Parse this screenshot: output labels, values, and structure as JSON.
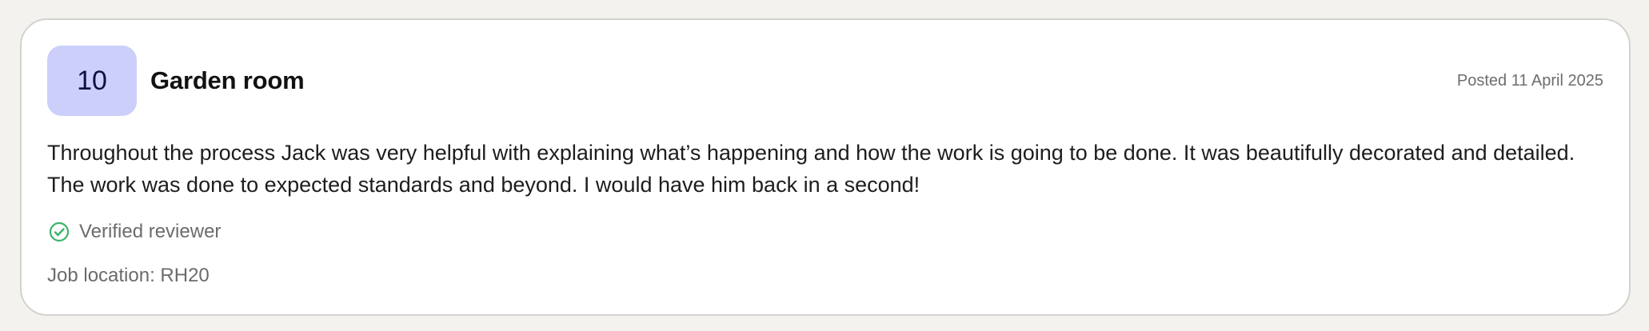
{
  "review": {
    "score": "10",
    "title": "Garden room",
    "posted": "Posted 11 April 2025",
    "text": "Throughout the process Jack was very helpful with explaining what’s happening and how the work is going to be done. It was beautifully decorated and detailed. The work was done to expected standards and beyond. I would have him back in a second!",
    "verified_label": "Verified reviewer",
    "location": "Job location: RH20"
  },
  "colors": {
    "badge_bg": "#cbcffa",
    "badge_text": "#101044",
    "verified_green": "#3db36b"
  },
  "icons": {
    "verified": "check-circle-icon"
  }
}
